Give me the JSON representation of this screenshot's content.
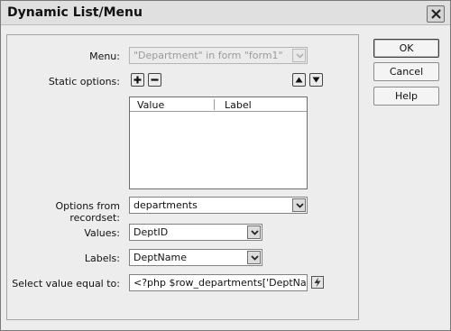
{
  "dialog": {
    "title": "Dynamic List/Menu"
  },
  "menu": {
    "label": "Menu:",
    "value": "\"Department\" in form \"form1\""
  },
  "static_options": {
    "label": "Static options:",
    "columns": [
      "Value",
      "Label"
    ]
  },
  "recordset": {
    "label": "Options from recordset:",
    "value": "departments"
  },
  "values": {
    "label": "Values:",
    "value": "DeptID"
  },
  "labels": {
    "label": "Labels:",
    "value": "DeptName"
  },
  "select_value": {
    "label": "Select value equal to:",
    "value": "<?php $row_departments['DeptName'] ?"
  },
  "buttons": {
    "ok": "OK",
    "cancel": "Cancel",
    "help": "Help"
  }
}
